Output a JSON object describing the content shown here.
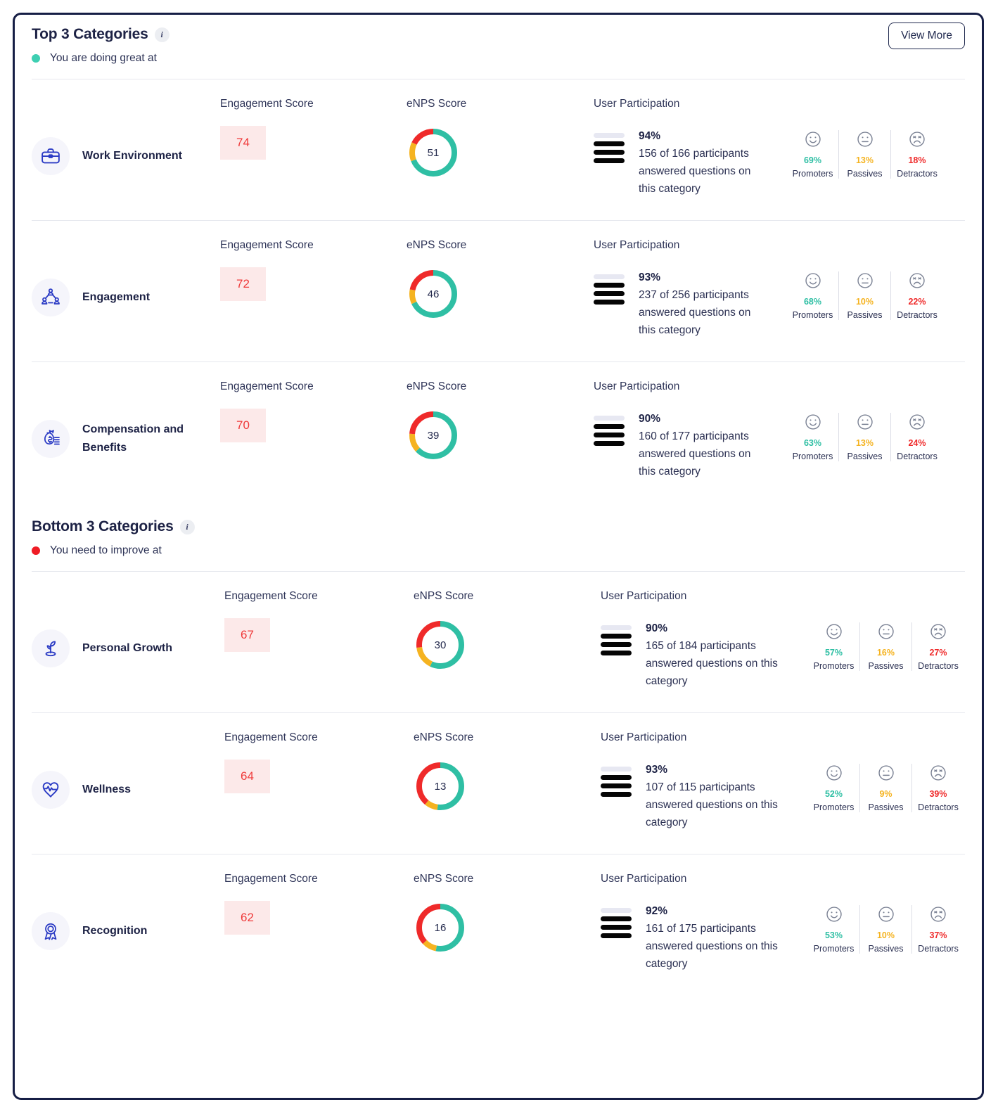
{
  "colors": {
    "promoters": "#2fbfa4",
    "passives": "#f5b320",
    "detractors": "#ef2a2a",
    "border": "#161e45",
    "badge_bg": "#fce9e9",
    "badge_text": "#ef3b3b"
  },
  "header": {
    "view_more_label": "View More"
  },
  "top_section": {
    "title": "Top 3 Categories",
    "info_icon": "info-icon",
    "subtitle": "You are doing great at",
    "dot_color": "#3ecfb2"
  },
  "bottom_section": {
    "title": "Bottom 3 Categories",
    "info_icon": "info-icon",
    "subtitle": "You need to improve at",
    "dot_color": "#ef1c25"
  },
  "labels": {
    "engagement_score": "Engagement Score",
    "enps_score": "eNPS Score",
    "user_participation": "User Participation",
    "promoters": "Promoters",
    "passives": "Passives",
    "detractors": "Detractors"
  },
  "chart_data": {
    "type": "pie",
    "title": "eNPS donut breakdown per category",
    "legend": [
      "Promoters",
      "Passives",
      "Detractors"
    ],
    "legend_colors": [
      "#2fbfa4",
      "#f5b320",
      "#ef2a2a"
    ],
    "series": [
      {
        "name": "Work Environment",
        "enps": 51,
        "values": [
          69,
          13,
          18
        ]
      },
      {
        "name": "Engagement",
        "enps": 46,
        "values": [
          68,
          10,
          22
        ]
      },
      {
        "name": "Compensation and Benefits",
        "enps": 39,
        "values": [
          63,
          13,
          24
        ]
      },
      {
        "name": "Personal Growth",
        "enps": 30,
        "values": [
          57,
          16,
          27
        ]
      },
      {
        "name": "Wellness",
        "enps": 13,
        "values": [
          52,
          9,
          39
        ]
      },
      {
        "name": "Recognition",
        "enps": 16,
        "values": [
          53,
          10,
          37
        ]
      }
    ]
  },
  "top_rows": [
    {
      "icon": "briefcase-icon",
      "name": "Work Environment",
      "engagement_score": "74",
      "enps_score": "51",
      "participation_pct": "94%",
      "participation_detail": "156 of 166 participants answered questions on this category",
      "gauge_filled": 3,
      "gauge_total": 4,
      "promoters": "69%",
      "passives": "13%",
      "detractors": "18%"
    },
    {
      "icon": "people-network-icon",
      "name": "Engagement",
      "engagement_score": "72",
      "enps_score": "46",
      "participation_pct": "93%",
      "participation_detail": "237 of 256 participants answered questions on this category",
      "gauge_filled": 3,
      "gauge_total": 4,
      "promoters": "68%",
      "passives": "10%",
      "detractors": "22%"
    },
    {
      "icon": "money-bag-icon",
      "name": "Compensation and Benefits",
      "engagement_score": "70",
      "enps_score": "39",
      "participation_pct": "90%",
      "participation_detail": "160 of 177 participants answered questions on this category",
      "gauge_filled": 3,
      "gauge_total": 4,
      "promoters": "63%",
      "passives": "13%",
      "detractors": "24%"
    }
  ],
  "bottom_rows": [
    {
      "icon": "plant-growth-icon",
      "name": "Personal Growth",
      "engagement_score": "67",
      "enps_score": "30",
      "participation_pct": "90%",
      "participation_detail": "165 of 184 participants answered questions on this category",
      "gauge_filled": 3,
      "gauge_total": 4,
      "promoters": "57%",
      "passives": "16%",
      "detractors": "27%"
    },
    {
      "icon": "heartbeat-icon",
      "name": "Wellness",
      "engagement_score": "64",
      "enps_score": "13",
      "participation_pct": "93%",
      "participation_detail": "107 of 115 participants answered questions on this category",
      "gauge_filled": 3,
      "gauge_total": 4,
      "promoters": "52%",
      "passives": "9%",
      "detractors": "39%"
    },
    {
      "icon": "award-ribbon-icon",
      "name": "Recognition",
      "engagement_score": "62",
      "enps_score": "16",
      "participation_pct": "92%",
      "participation_detail": "161 of 175 participants answered questions on this category",
      "gauge_filled": 3,
      "gauge_total": 4,
      "promoters": "53%",
      "passives": "10%",
      "detractors": "37%"
    }
  ]
}
